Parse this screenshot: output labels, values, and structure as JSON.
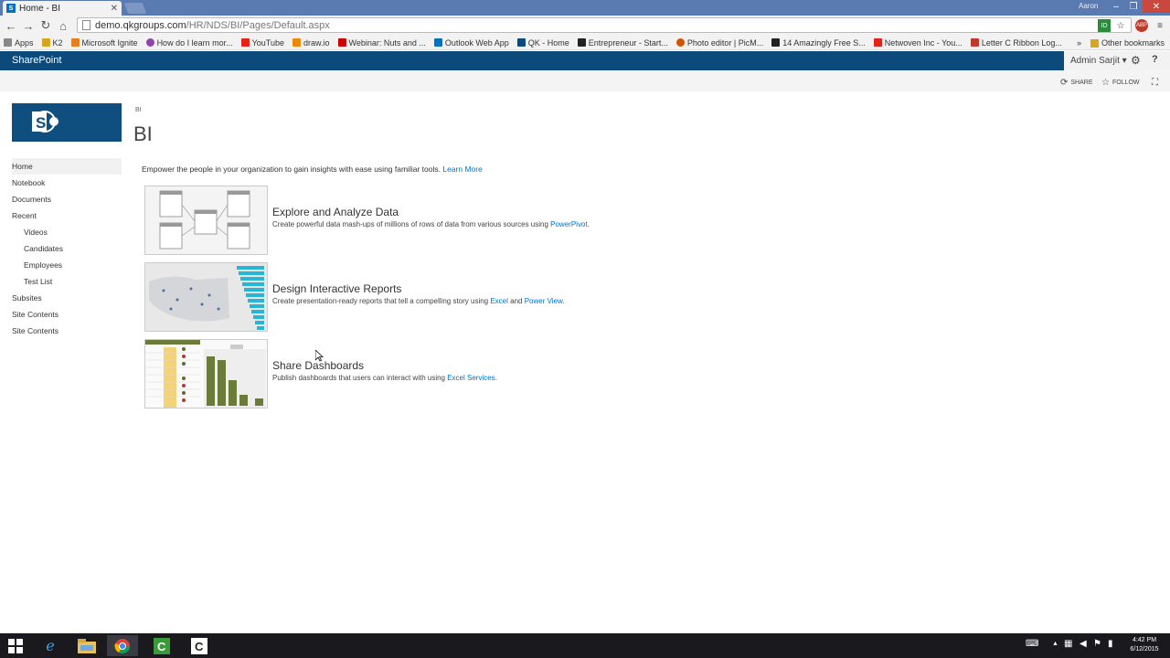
{
  "browser": {
    "tab_title": "Home - BI",
    "window_user": "Aaron",
    "url_host": "demo.qkgroups.com",
    "url_path": "/HR/NDS/BI/Pages/Default.aspx",
    "bookmarks": [
      {
        "label": "Apps",
        "color": "#888888"
      },
      {
        "label": "K2",
        "color": "#d9a520"
      },
      {
        "label": "Microsoft Ignite",
        "color": "#e67e22"
      },
      {
        "label": "How do I learn mor...",
        "color": "#8e44ad"
      },
      {
        "label": "YouTube",
        "color": "#e62117"
      },
      {
        "label": "draw.io",
        "color": "#f08705"
      },
      {
        "label": "Webinar: Nuts and ...",
        "color": "#cc0000"
      },
      {
        "label": "Outlook Web App",
        "color": "#0072c6"
      },
      {
        "label": "QK - Home",
        "color": "#0c4a7c"
      },
      {
        "label": "Entrepreneur - Start...",
        "color": "#222222"
      },
      {
        "label": "Photo editor | PicM...",
        "color": "#d35400"
      },
      {
        "label": "14 Amazingly Free S...",
        "color": "#222222"
      },
      {
        "label": "Netwoven Inc - You...",
        "color": "#e62117"
      },
      {
        "label": "Letter C Ribbon Log...",
        "color": "#c0392b"
      }
    ],
    "other_bookmarks": "Other bookmarks",
    "overflow": "»"
  },
  "suitebar": {
    "brand": "SharePoint",
    "user": "Admin Sarjit ▾"
  },
  "ribbon": {
    "share": "SHARE",
    "follow": "FOLLOW"
  },
  "site": {
    "breadcrumb": "BI",
    "title": "BI"
  },
  "quicklaunch": [
    {
      "label": "Home",
      "selected": true,
      "sub": false
    },
    {
      "label": "Notebook",
      "selected": false,
      "sub": false
    },
    {
      "label": "Documents",
      "selected": false,
      "sub": false
    },
    {
      "label": "Recent",
      "selected": false,
      "sub": false
    },
    {
      "label": "Videos",
      "selected": false,
      "sub": true
    },
    {
      "label": "Candidates",
      "selected": false,
      "sub": true
    },
    {
      "label": "Employees",
      "selected": false,
      "sub": true
    },
    {
      "label": "Test List",
      "selected": false,
      "sub": true
    },
    {
      "label": "Subsites",
      "selected": false,
      "sub": false
    },
    {
      "label": "Site Contents",
      "selected": false,
      "sub": false
    },
    {
      "label": "Site Contents",
      "selected": false,
      "sub": false
    }
  ],
  "intro": {
    "text": "Empower the people in your organization to gain insights with ease using familiar tools.",
    "link": "Learn More"
  },
  "cards": [
    {
      "title": "Explore and Analyze Data",
      "desc_pre": "Create powerful data mash-ups of millions of rows of data from various sources using ",
      "link1": "PowerPivot",
      "mid": "",
      "link2": "",
      "desc_post": "."
    },
    {
      "title": "Design Interactive Reports",
      "desc_pre": "Create presentation-ready reports that tell a compelling story using ",
      "link1": "Excel",
      "mid": " and ",
      "link2": "Power View",
      "desc_post": "."
    },
    {
      "title": "Share Dashboards",
      "desc_pre": "Publish dashboards that users can interact with using ",
      "link1": "Excel Services",
      "mid": "",
      "link2": "",
      "desc_post": "."
    }
  ],
  "taskbar": {
    "time": "4:42 PM",
    "date": "6/12/2015"
  },
  "colors": {
    "suite_blue": "#0c4a7c",
    "link_blue": "#0072c6",
    "logo_blue": "#0e4f7f"
  }
}
